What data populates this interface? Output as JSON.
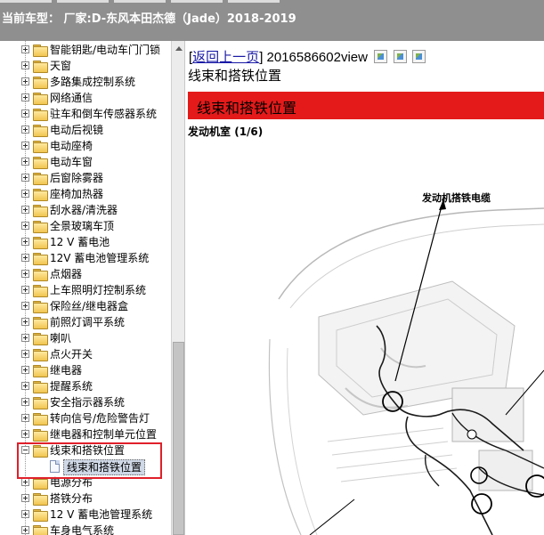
{
  "header": {
    "title": "当前车型： 厂家:D-东风本田杰德（Jade）2018-2019"
  },
  "tree": {
    "items": [
      {
        "label": "智能钥匙/电动车门门锁",
        "type": "folder"
      },
      {
        "label": "天窗",
        "type": "folder"
      },
      {
        "label": "多路集成控制系统",
        "type": "folder"
      },
      {
        "label": "网络通信",
        "type": "folder"
      },
      {
        "label": "驻车和倒车传感器系统",
        "type": "folder"
      },
      {
        "label": "电动后视镜",
        "type": "folder"
      },
      {
        "label": "电动座椅",
        "type": "folder"
      },
      {
        "label": "电动车窗",
        "type": "folder"
      },
      {
        "label": "后窗除雾器",
        "type": "folder"
      },
      {
        "label": "座椅加热器",
        "type": "folder"
      },
      {
        "label": "刮水器/清洗器",
        "type": "folder"
      },
      {
        "label": "全景玻璃车顶",
        "type": "folder"
      },
      {
        "label": "12 V 蓄电池",
        "type": "folder"
      },
      {
        "label": "12V 蓄电池管理系统",
        "type": "folder"
      },
      {
        "label": "点烟器",
        "type": "folder"
      },
      {
        "label": "上车照明灯控制系统",
        "type": "folder"
      },
      {
        "label": "保险丝/继电器盒",
        "type": "folder"
      },
      {
        "label": "前照灯调平系统",
        "type": "folder"
      },
      {
        "label": "喇叭",
        "type": "folder"
      },
      {
        "label": "点火开关",
        "type": "folder"
      },
      {
        "label": "继电器",
        "type": "folder"
      },
      {
        "label": "提醒系统",
        "type": "folder"
      },
      {
        "label": "安全指示器系统",
        "type": "folder"
      },
      {
        "label": "转向信号/危险警告灯",
        "type": "folder"
      },
      {
        "label": "继电器和控制单元位置",
        "type": "folder"
      },
      {
        "label": "线束和搭铁位置",
        "type": "folder-open"
      },
      {
        "label": "线束和搭铁位置",
        "type": "doc",
        "selected": true
      },
      {
        "label": "电源分布",
        "type": "folder"
      },
      {
        "label": "搭铁分布",
        "type": "folder"
      },
      {
        "label": "12 V 蓄电池管理系统",
        "type": "folder"
      },
      {
        "label": "车身电气系统",
        "type": "folder"
      }
    ]
  },
  "content": {
    "nav_open": "[",
    "back_link": "返回上一页",
    "nav_close": "]",
    "doc_id": "2016586602view",
    "page_title": "线束和搭铁位置",
    "section_bar": "线束和搭铁位置",
    "section_label": "发动机室",
    "section_page": "(1/6)",
    "callout": "发动机搭铁电缆"
  },
  "colors": {
    "header_bg": "#8f8f8f",
    "section_bar": "#e41a1a",
    "highlight": "#e0202a",
    "link": "#1a1aa6"
  }
}
